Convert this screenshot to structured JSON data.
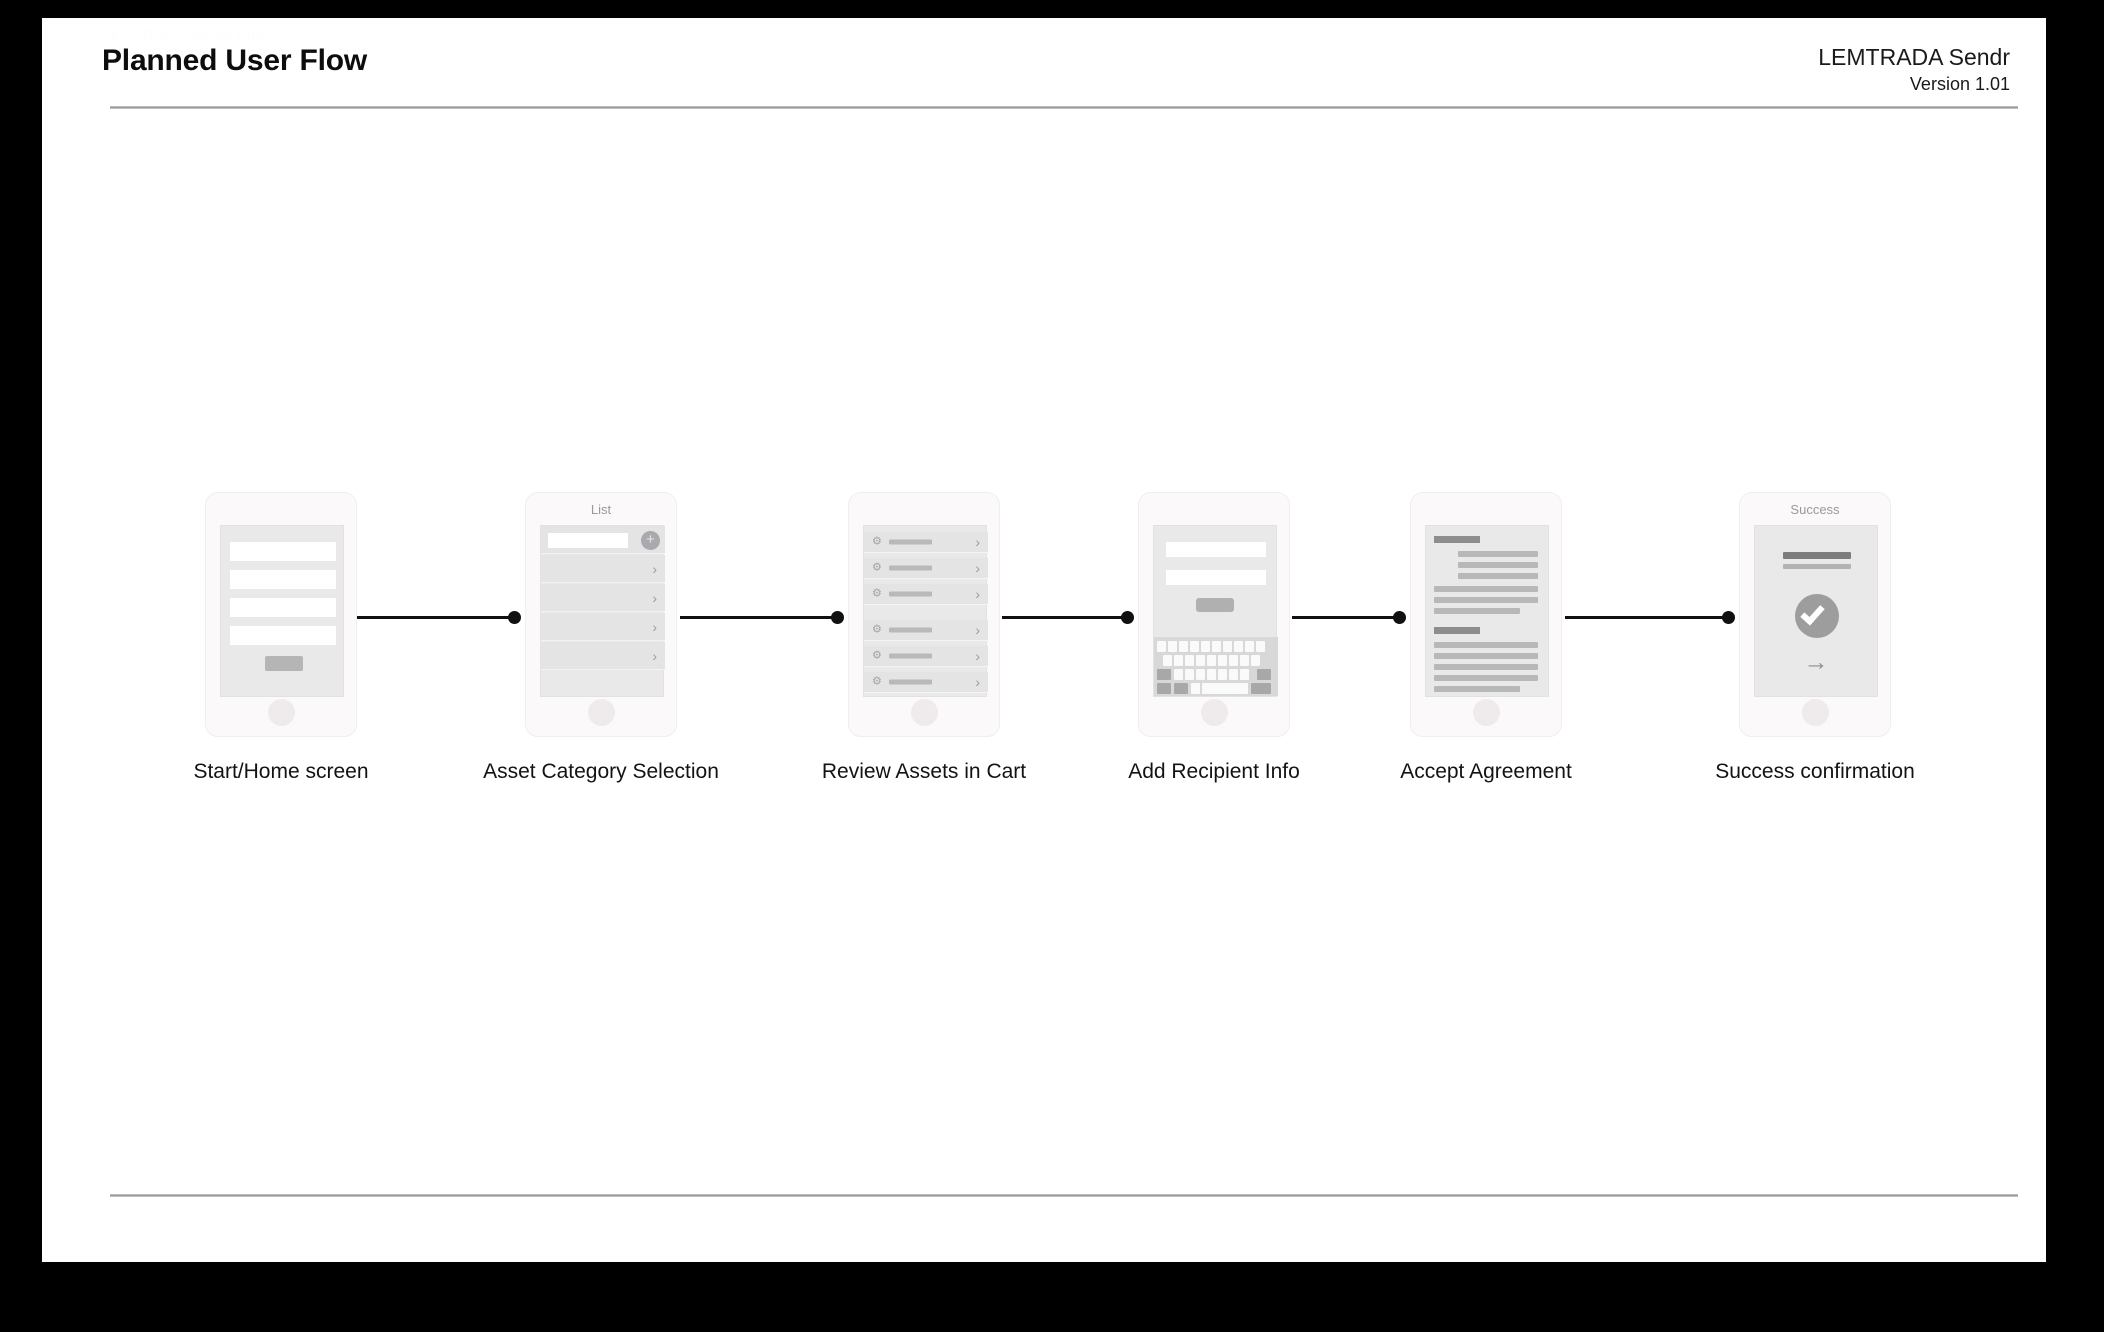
{
  "header": {
    "eyebrow": "LEMTRADA Sendr App",
    "title": "Planned User Flow",
    "doc_name": "LEMTRADA Sendr",
    "version": "Version 1.01"
  },
  "theme": {
    "page_background": "#ffffff",
    "slide_border": "#000000",
    "connector_color": "#111111",
    "phone_body": "#fbf9f9",
    "screen_fill": "#e9e9e9",
    "accent_gray": "#9d9d9d"
  },
  "flow": {
    "steps": [
      {
        "id": "start-home",
        "caption": "Start/Home screen",
        "screen_title": "",
        "screen_type": "form",
        "fields": 4,
        "button_label": ""
      },
      {
        "id": "asset-category",
        "caption": "Asset Category Selection",
        "screen_title": "List",
        "screen_type": "list",
        "add_icon": "plus-icon",
        "rows": 4,
        "row_chevron": "›"
      },
      {
        "id": "review-cart",
        "caption": "Review Assets in Cart",
        "screen_title": "",
        "screen_type": "cart",
        "rows": 6,
        "row_icon": "gear-icon",
        "row_chevron": "›"
      },
      {
        "id": "add-recipient",
        "caption": "Add Recipient Info",
        "screen_title": "",
        "screen_type": "keyboard",
        "fields": 2,
        "button_label": ""
      },
      {
        "id": "accept-agreement",
        "caption": "Accept Agreement",
        "screen_title": "",
        "screen_type": "document",
        "sections": 2
      },
      {
        "id": "success-confirmation",
        "caption": "Success confirmation",
        "screen_title": "Success",
        "screen_type": "success",
        "status_icon": "check-circle-icon",
        "next_icon": "→"
      }
    ]
  }
}
